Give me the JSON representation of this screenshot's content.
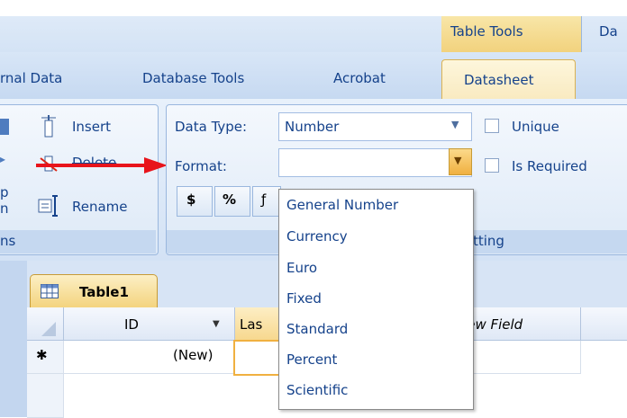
{
  "context_tab": {
    "group_label": "Table Tools",
    "partial_label": "Da"
  },
  "tabs": [
    {
      "label": "rnal Data"
    },
    {
      "label": "Database Tools"
    },
    {
      "label": "Acrobat"
    },
    {
      "label": "Datasheet"
    }
  ],
  "left_group": {
    "insert_label": "Insert",
    "delete_label": "Delete",
    "rename_label": "Rename",
    "partial_top": "p",
    "partial_bottom": "n",
    "footer": "ns"
  },
  "format_group": {
    "data_type_label": "Data Type:",
    "data_type_value": "Number",
    "format_label": "Format:",
    "format_value": "",
    "unique_label": "Unique",
    "required_label": "Is Required",
    "currency_symbol": "$",
    "percent_symbol": "%",
    "comma_partial": "ƒ",
    "footer_partial": "tting"
  },
  "format_options": [
    "General Number",
    "Currency",
    "Euro",
    "Fixed",
    "Standard",
    "Percent",
    "Scientific"
  ],
  "datasheet": {
    "tab_label": "Table1",
    "columns": [
      "ID",
      "Las",
      "New Field"
    ],
    "new_row_marker": "✱",
    "new_row_value": "(New)"
  },
  "colors": {
    "annotation_arrow": "#e8141b",
    "accent": "#f3d27a"
  }
}
